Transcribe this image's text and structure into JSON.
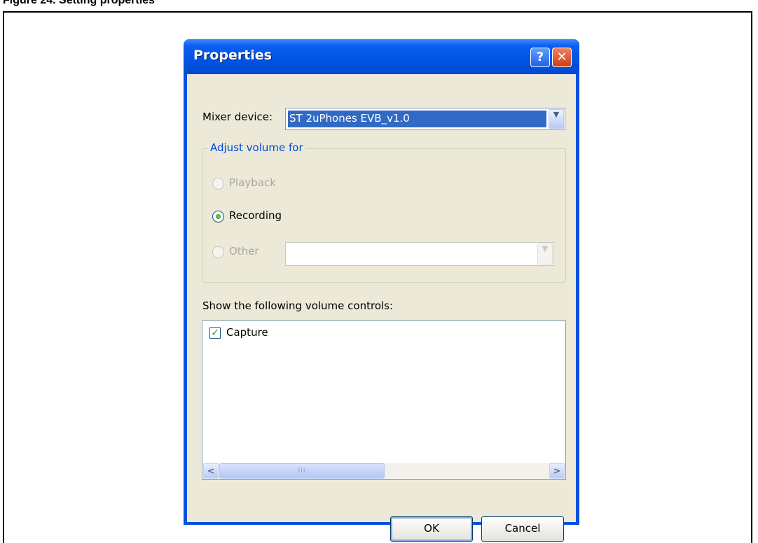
{
  "caption": "Figure 24. Setting properties",
  "dialog": {
    "title": "Properties",
    "help_glyph": "?",
    "close_glyph": "✕"
  },
  "mixer": {
    "label": "Mixer device:",
    "value": "ST 2uPhones EVB_v1.0"
  },
  "adjust_group": {
    "title": "Adjust volume for",
    "options": [
      {
        "label": "Playback",
        "selected": false,
        "enabled": false
      },
      {
        "label": "Recording",
        "selected": true,
        "enabled": true
      },
      {
        "label": "Other",
        "selected": false,
        "enabled": false
      }
    ],
    "other_combo_value": ""
  },
  "controls": {
    "label": "Show the following volume controls:",
    "items": [
      {
        "label": "Capture",
        "checked": true
      }
    ],
    "scroll_thumb_glyph": "III"
  },
  "buttons": {
    "ok": "OK",
    "cancel": "Cancel"
  },
  "colors": {
    "titlebar": "#0054e3",
    "dialog_face": "#ece9d8",
    "selection": "#316ac5",
    "group_title": "#0046d5"
  }
}
